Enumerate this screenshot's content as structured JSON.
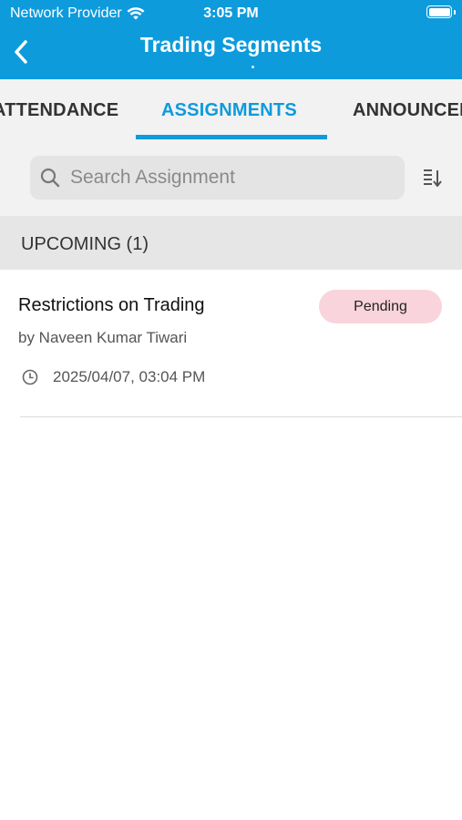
{
  "status_bar": {
    "carrier": "Network Provider",
    "time": "3:05 PM"
  },
  "header": {
    "title": "Trading Segments"
  },
  "tabs": [
    {
      "label": "ATTENDANCE"
    },
    {
      "label": "ASSIGNMENTS",
      "active": true
    },
    {
      "label": "ANNOUNCEMENTS"
    }
  ],
  "search": {
    "placeholder": "Search Assignment",
    "value": ""
  },
  "section": {
    "title": "UPCOMING (1)"
  },
  "assignments": [
    {
      "title": "Restrictions on Trading",
      "author": "by Naveen Kumar Tiwari",
      "due": "2025/04/07, 03:04 PM",
      "status": "Pending"
    }
  ],
  "colors": {
    "accent": "#0d9bdc",
    "pending_badge": "#f9d4dc"
  }
}
